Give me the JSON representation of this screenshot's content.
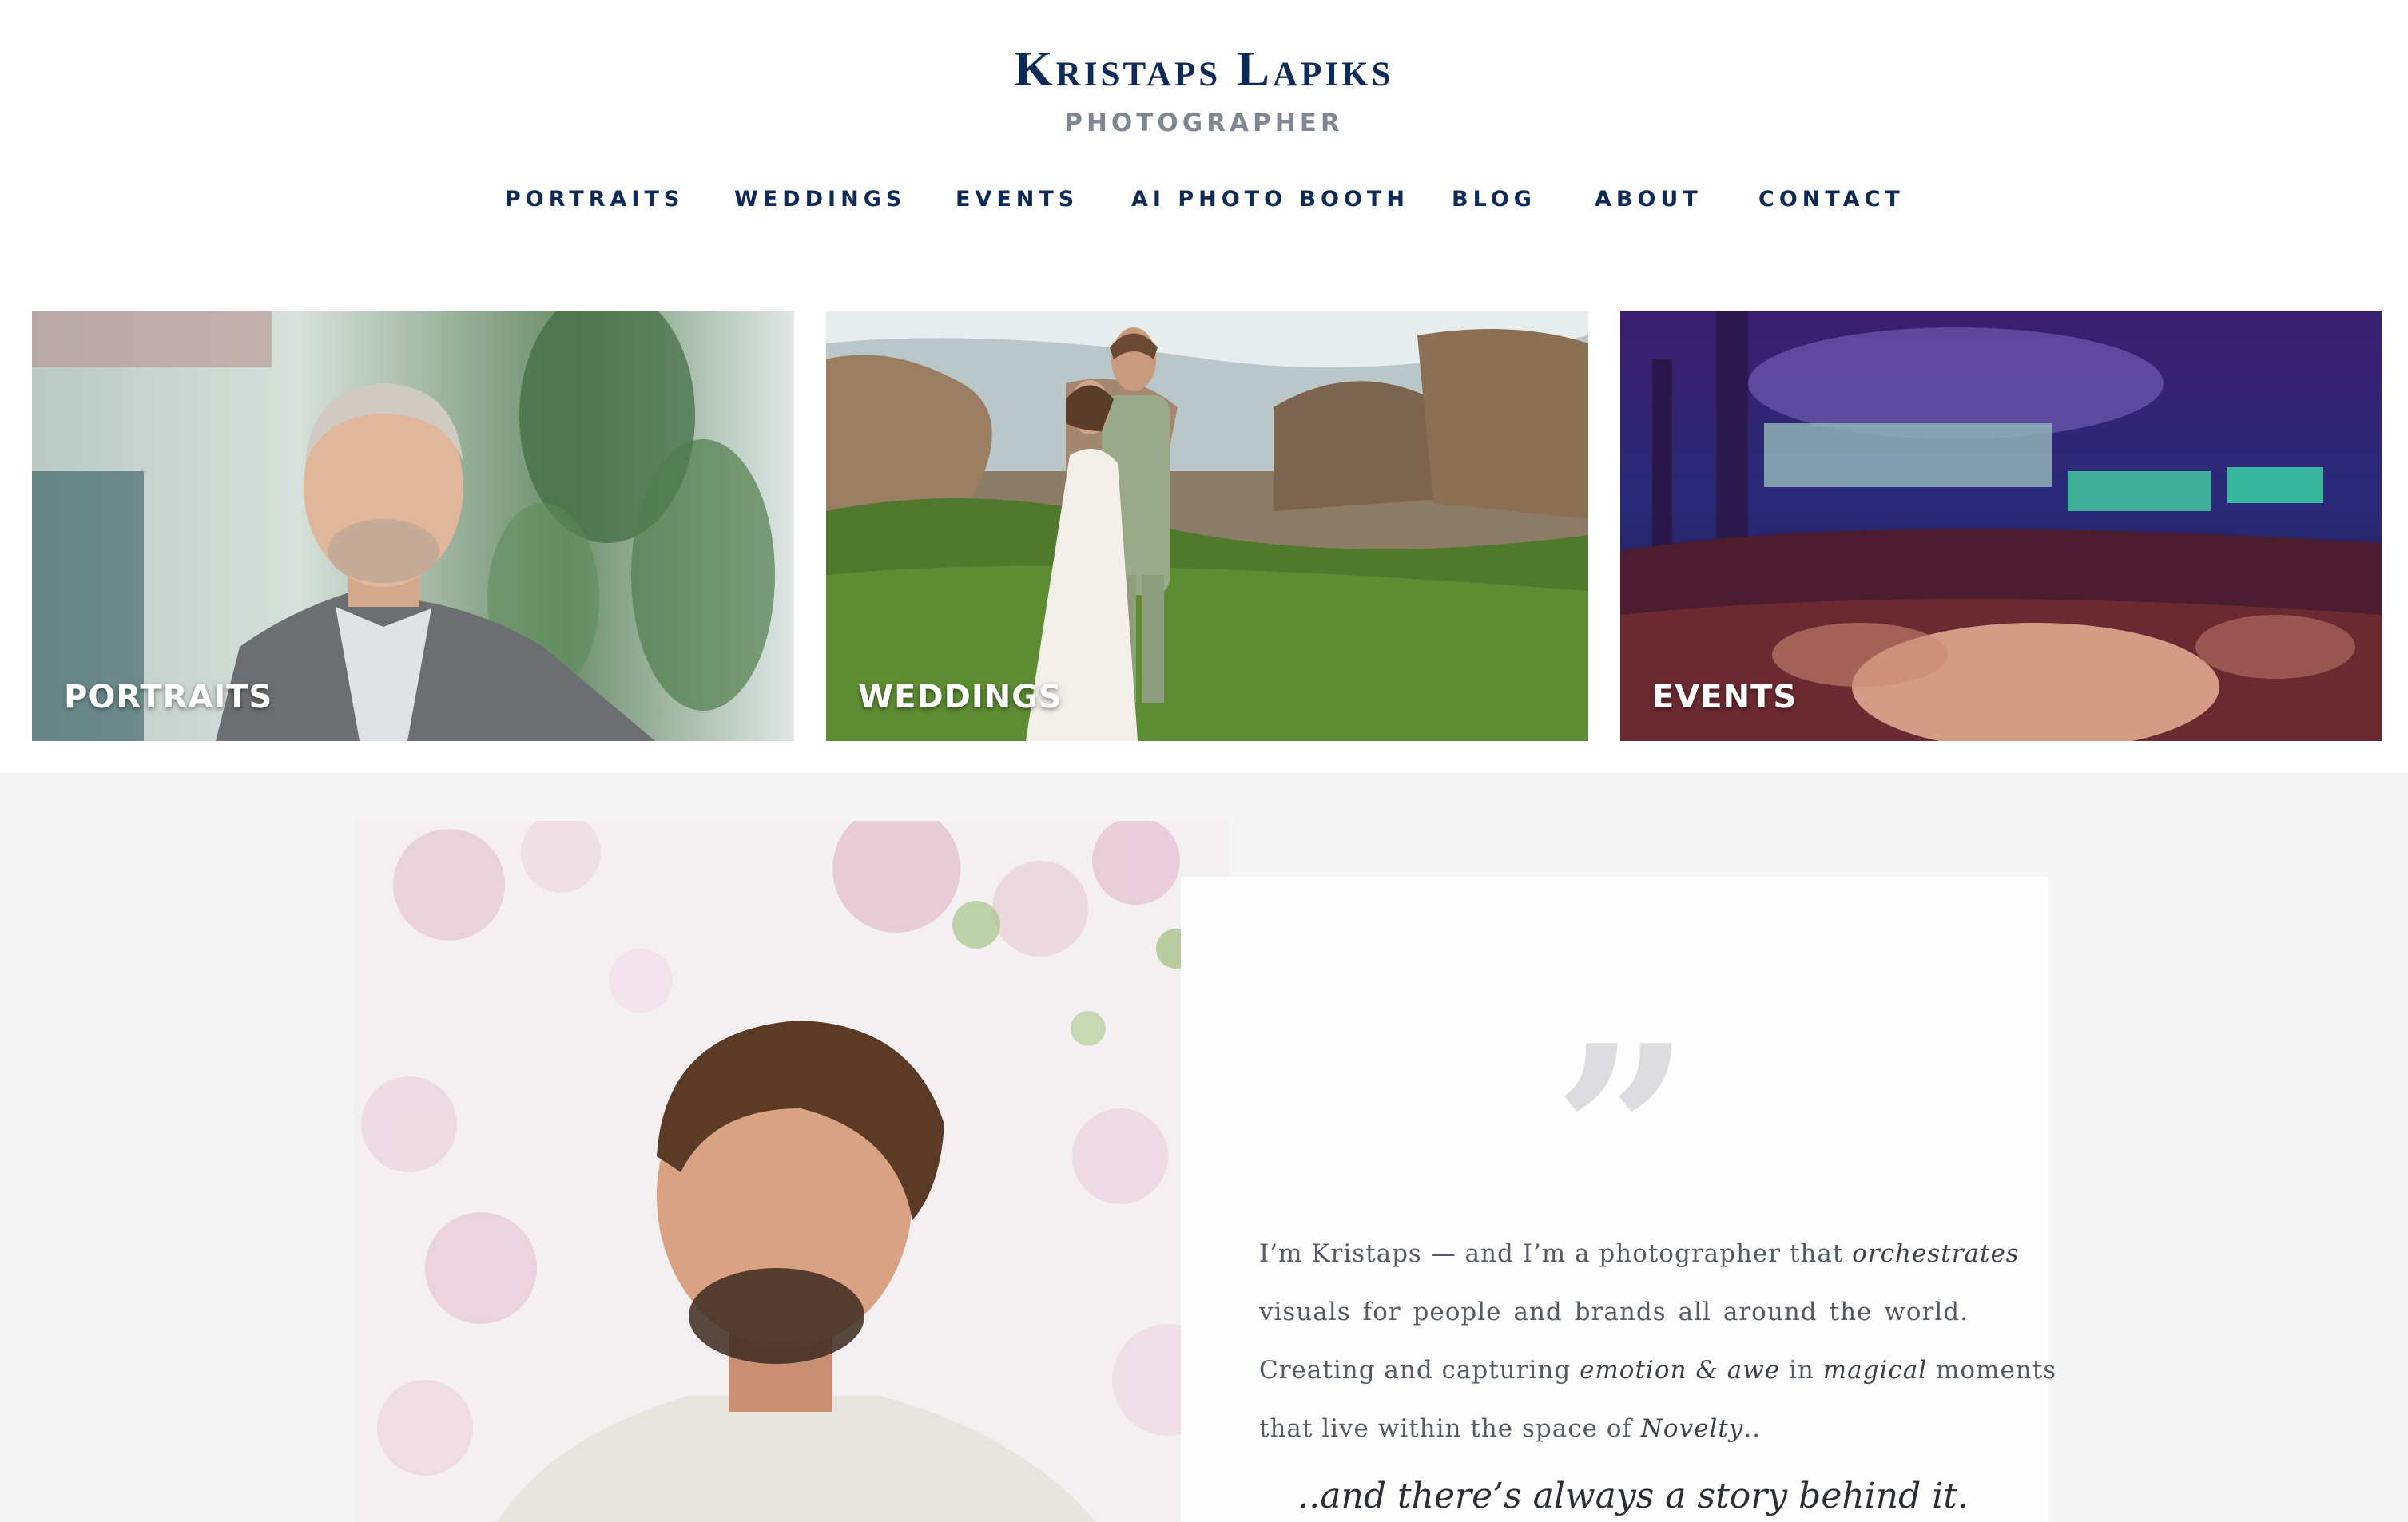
{
  "header": {
    "name": "Kristaps Lapiks",
    "subtitle": "PHOTOGRAPHER"
  },
  "nav": {
    "items": [
      {
        "label": "PORTRAITS"
      },
      {
        "label": "WEDDINGS"
      },
      {
        "label": "EVENTS"
      },
      {
        "label": "AI PHOTO BOOTH"
      },
      {
        "label": "BLOG"
      },
      {
        "label": "ABOUT"
      },
      {
        "label": "CONTACT"
      }
    ]
  },
  "tiles": [
    {
      "label": "PORTRAITS"
    },
    {
      "label": "WEDDINGS"
    },
    {
      "label": "EVENTS"
    }
  ],
  "about": {
    "quote_glyph": "”",
    "bio_lines": [
      [
        "I’m Kristaps — and I’m a photographer that ",
        "orchestrates",
        ""
      ],
      [
        "visuals for people and brands all around the world.",
        "",
        ""
      ],
      [
        "Creating and capturing ",
        "emotion & awe",
        " in "
      ],
      [
        "that live within the space of ",
        "Novelty",
        ".."
      ]
    ],
    "bio_line3_tail": {
      "em": "magical",
      "text": " moments"
    },
    "tagline": "..and there’s always a story behind it."
  },
  "colors": {
    "brand_navy": "#0d2a59",
    "subtitle_gray": "#7f8892",
    "section_bg": "#f6f5f6"
  }
}
